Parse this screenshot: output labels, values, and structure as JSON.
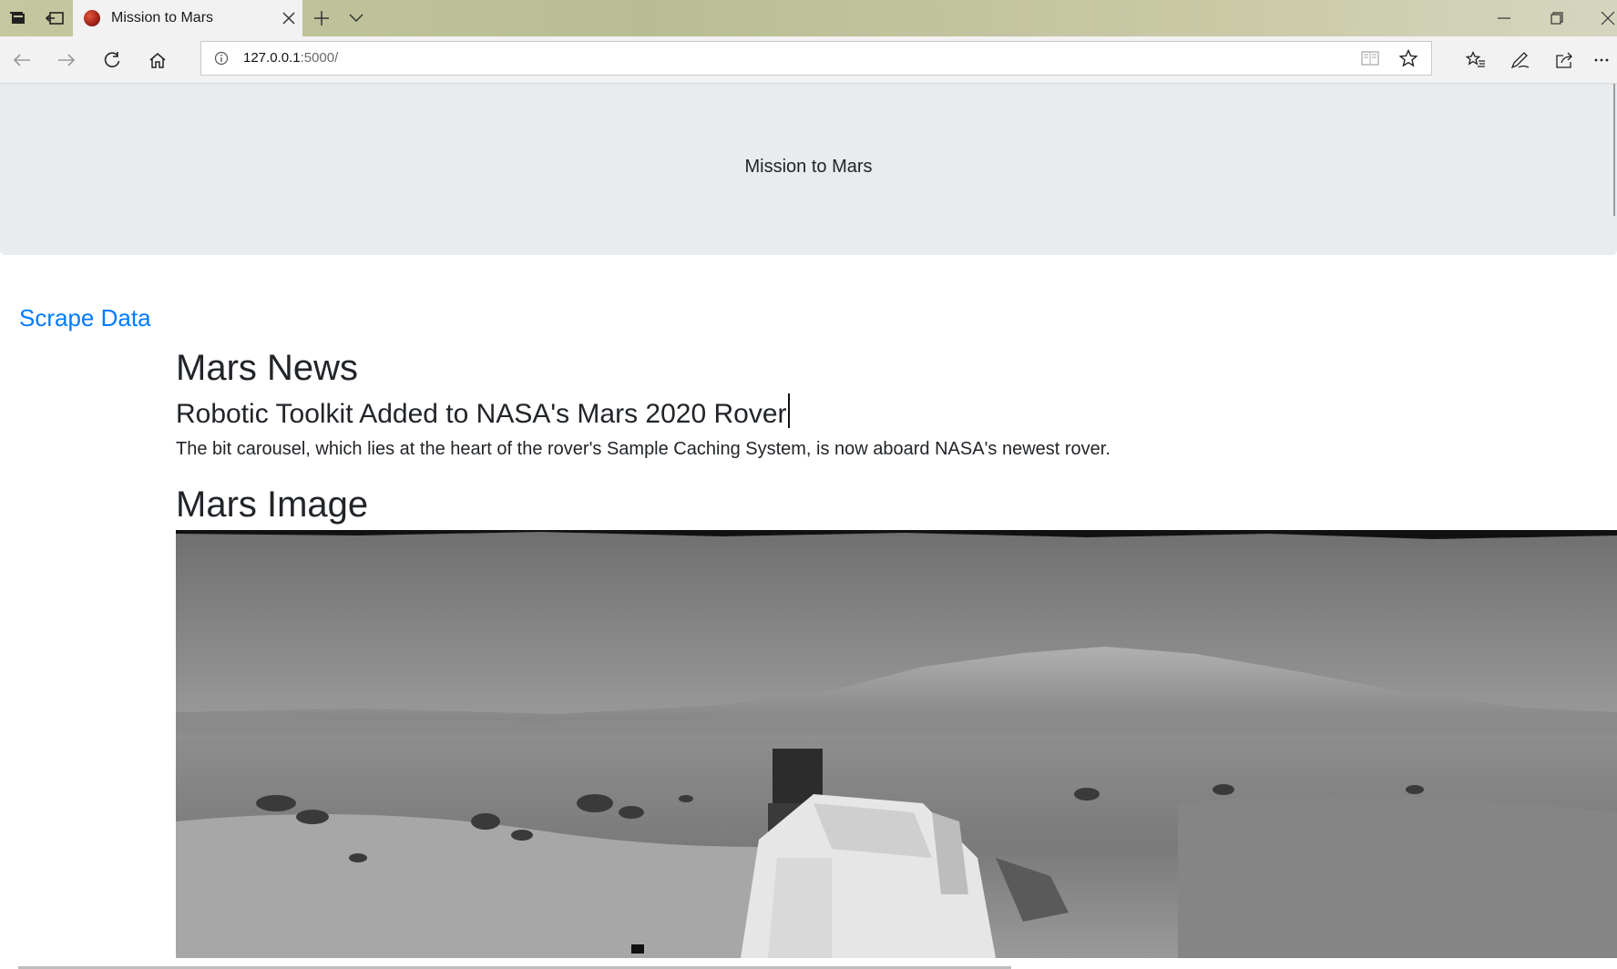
{
  "browser": {
    "tab_title": "Mission to Mars",
    "url_host": "127.0.0.1",
    "url_path": ":5000/"
  },
  "page": {
    "jumbotron_title": "Mission to Mars",
    "scrape_link": "Scrape Data",
    "news_heading": "Mars News",
    "news_title": "Robotic Toolkit Added to NASA's Mars 2020 Rover",
    "news_paragraph": "The bit carousel, which lies at the heart of the rover's Sample Caching System, is now aboard NASA's newest rover.",
    "image_heading": "Mars Image"
  },
  "colors": {
    "link": "#007bff",
    "jumbotron_bg": "#e9ecef",
    "text": "#212529"
  },
  "icons": {
    "tab_bar": [
      "tab-list-icon",
      "set-aside-tabs-icon"
    ],
    "tab": [
      "mars-favicon",
      "close-tab-icon"
    ],
    "tab_actions": [
      "new-tab-icon",
      "tab-preview-chevron-icon"
    ],
    "window": [
      "minimize-icon",
      "restore-icon",
      "close-window-icon"
    ],
    "nav": [
      "back-arrow-icon",
      "forward-arrow-icon",
      "refresh-icon",
      "home-icon"
    ],
    "address": [
      "site-info-icon",
      "reading-view-icon",
      "favorite-star-icon"
    ],
    "tools": [
      "favorites-hub-icon",
      "web-note-icon",
      "share-icon",
      "more-icon"
    ]
  }
}
